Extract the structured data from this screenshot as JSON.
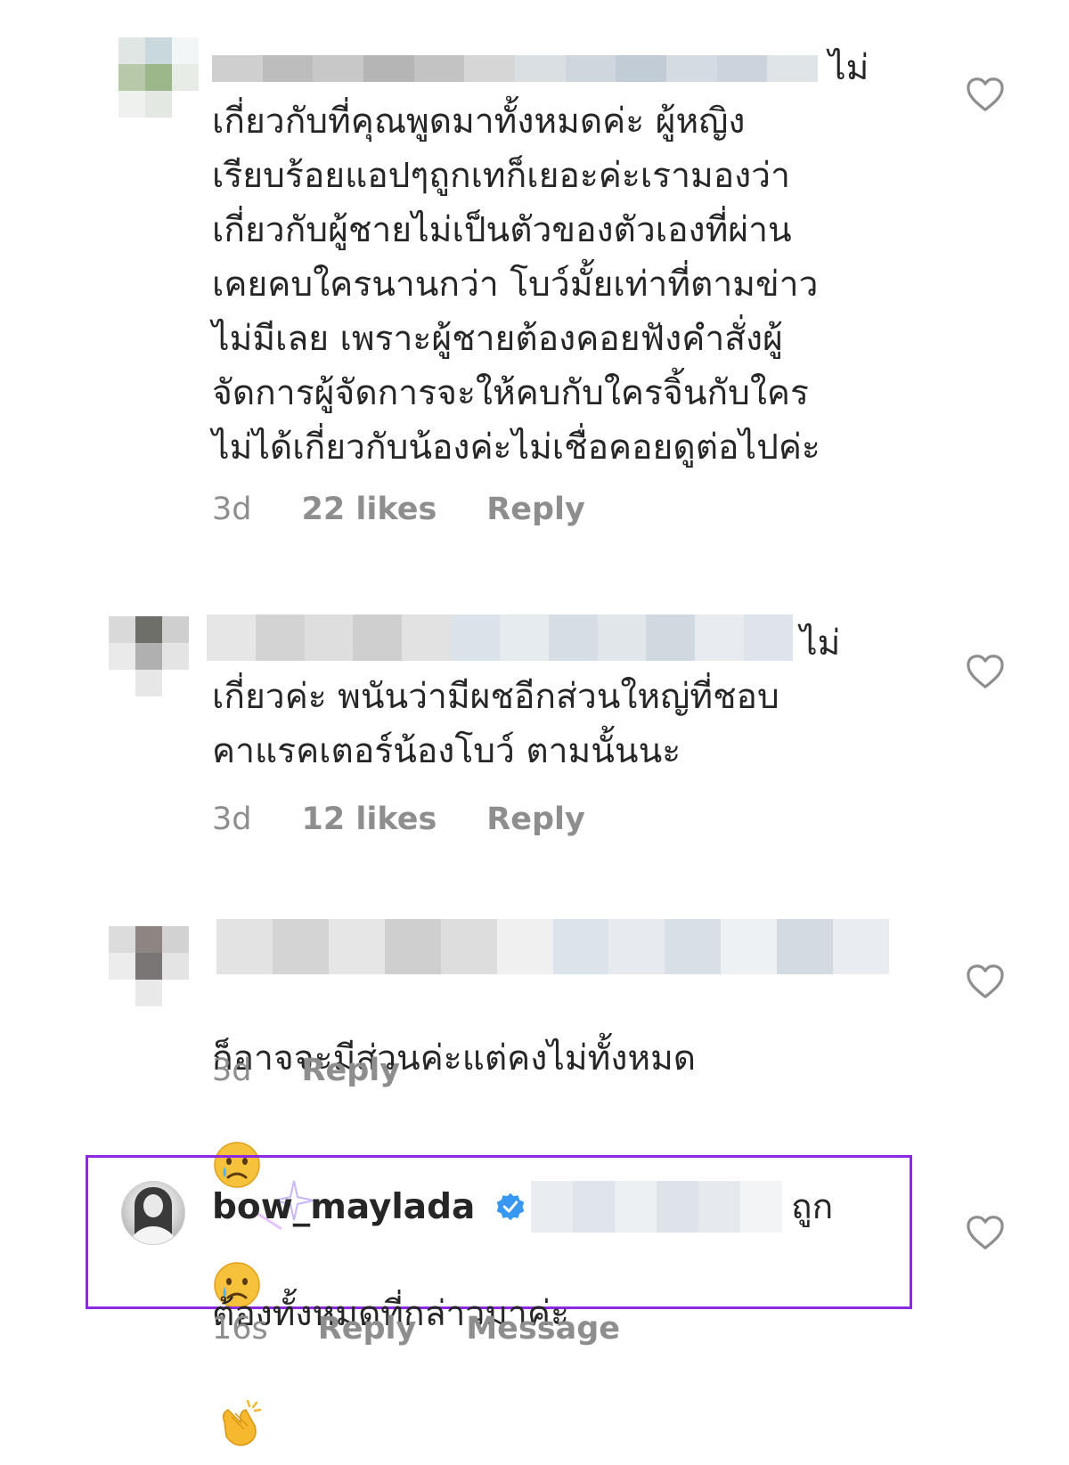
{
  "comments": [
    {
      "text_tail": "ไม่",
      "text": "เกี่ยวกับที่คุณพูดมาทั้งหมดค่ะ ผู้หญิง\nเรียบร้อยแอปๆถูกเทก็เยอะค่ะเรามองว่า\nเกี่ยวกับผู้ชายไม่เป็นตัวของตัวเองที่ผ่าน\nเคยคบใครนานกว่า โบว์มั้ยเท่าที่ตามข่าว\nไม่มีเลย เพราะผู้ชายต้องคอยฟังคำสั่งผู้\nจัดการผู้จัดการจะให้คบกับใครจิ้นกับใคร\nไม่ได้เกี่ยวกับน้องค่ะไม่เชื่อคอยดูต่อไปค่ะ",
      "time": "3d",
      "likes": "22 likes",
      "reply": "Reply"
    },
    {
      "text_tail": "ไม่",
      "text": "เกี่ยวค่ะ พนันว่ามีผชอีกส่วนใหญ่ที่ชอบ\nคาแรคเตอร์น้องโบว์ ตามนั้นนะ",
      "time": "3d",
      "likes": "12 likes",
      "reply": "Reply"
    },
    {
      "text": "ก็อาจจะมีส่วนค่ะแต่คงไม่ทั้งหมด",
      "emoji": "crying-face-emoji",
      "time": "3d",
      "reply": "Reply"
    },
    {
      "username": "bow_maylada",
      "text_tail": "ถูก",
      "text": "ต้องทั้งหมดที่กล่าวมาค่ะ",
      "emoji": "clapping-hands-emoji",
      "time": "16s",
      "reply": "Reply",
      "message": "Message"
    }
  ],
  "colors": {
    "text": "#262626",
    "meta": "#8e8e8e",
    "highlight": "#8a2be2",
    "verified": "#3897f0"
  },
  "icons": [
    "heart-outline-icon",
    "verified-badge-icon"
  ]
}
